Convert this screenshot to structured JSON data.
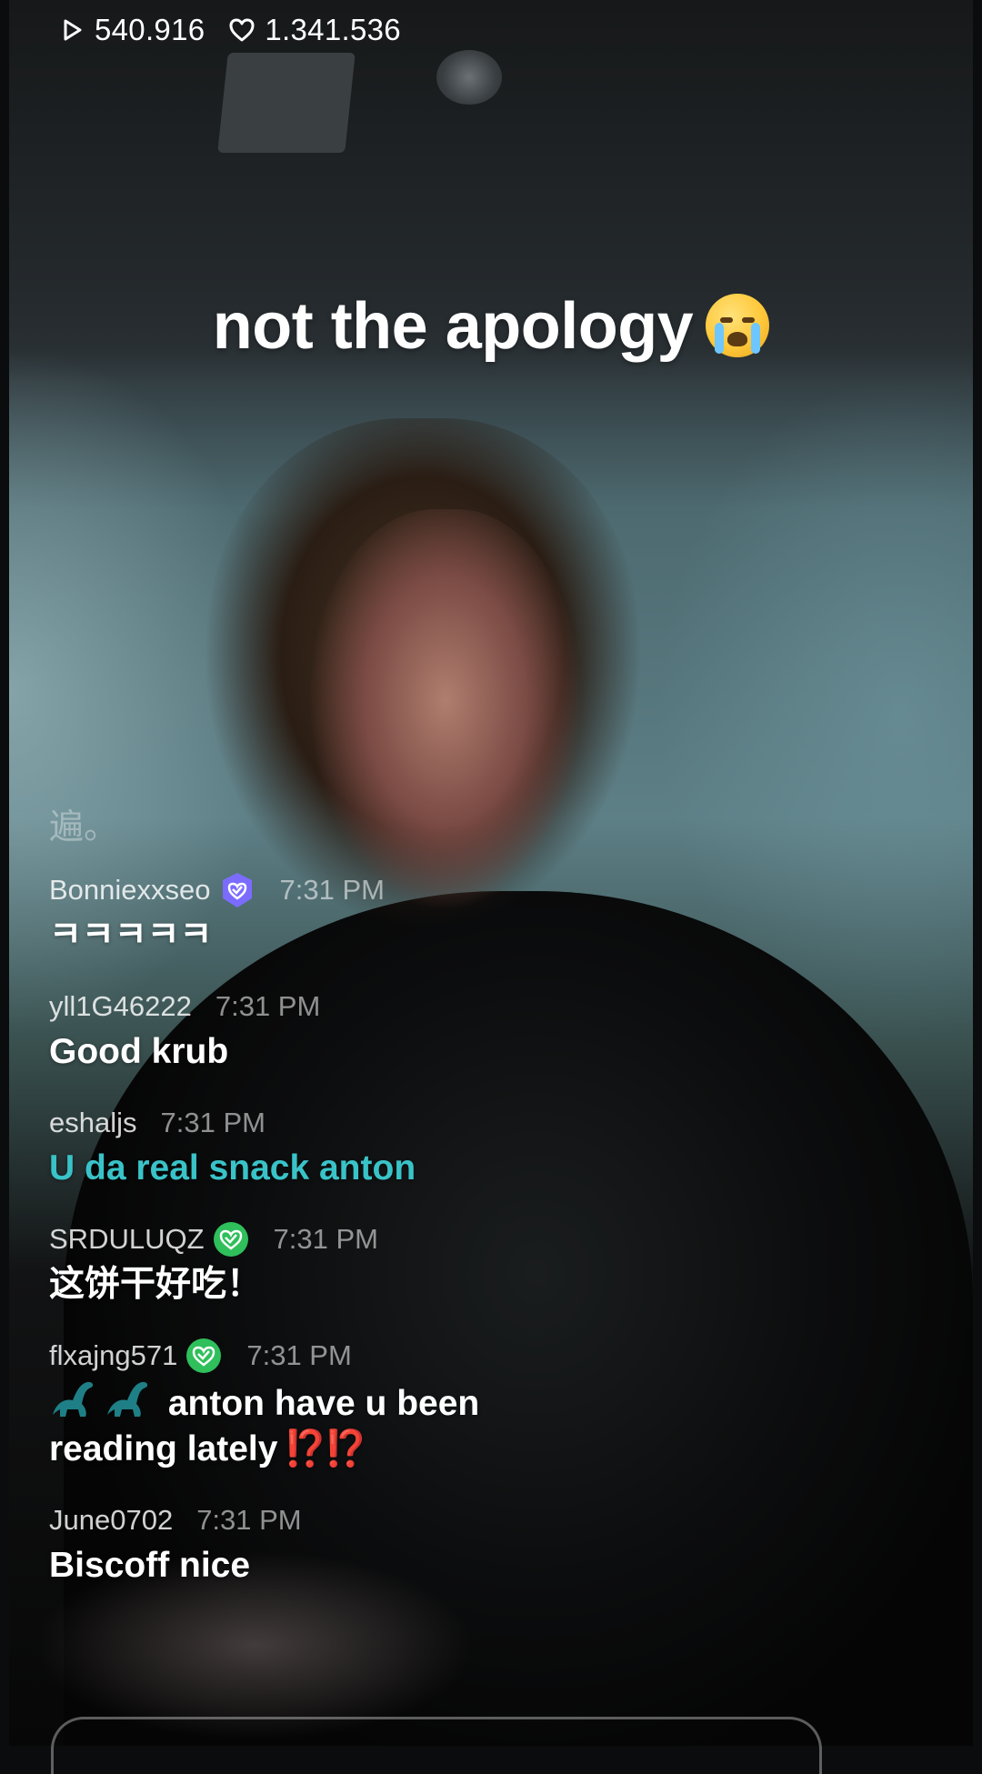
{
  "stats": {
    "views": "540.916",
    "likes": "1.341.536"
  },
  "caption": {
    "text": "not the apology"
  },
  "faded_text": "遍。",
  "chat": [
    {
      "user": "Bonniexxseo",
      "badge": "purple-heart-shield",
      "time": "7:31 PM",
      "text": "ㅋㅋㅋㅋㅋ",
      "color": "#ffffff"
    },
    {
      "user": "yll1G46222",
      "badge": "",
      "time": "7:31 PM",
      "text": "Good krub",
      "color": "#ffffff"
    },
    {
      "user": "eshaljs",
      "badge": "",
      "time": "7:31 PM",
      "text": "U da real snack anton",
      "color": "#39c3c8"
    },
    {
      "user": "SRDULUQZ",
      "badge": "green-heart-check",
      "time": "7:31 PM",
      "text": "这饼干好吃！",
      "color": "#ffffff"
    },
    {
      "user": "flxajng571",
      "badge": "green-heart-check",
      "time": "7:31 PM",
      "text_line1": "anton have u been",
      "text_line2": "reading lately",
      "emoji_suffix": "⁉️⁉️",
      "color": "#ffffff"
    },
    {
      "user": "June0702",
      "badge": "",
      "time": "7:31 PM",
      "text": "Biscoff nice",
      "color": "#ffffff"
    }
  ],
  "colors": {
    "accent_teal": "#39c3c8",
    "badge_green": "#2fbf5b",
    "badge_purple": "#7b6cff",
    "alert_red": "#e02828"
  },
  "icons": {
    "views": "play-icon",
    "likes": "heart-icon",
    "caption_emoji": "loudly-crying-face-emoji",
    "dino": "sauropod-emoji"
  }
}
